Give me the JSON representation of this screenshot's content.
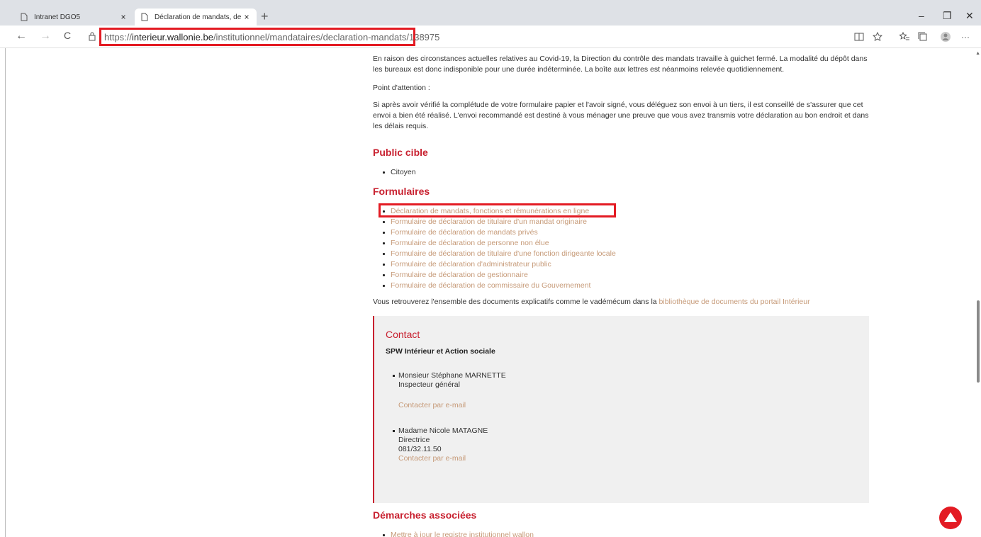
{
  "browser": {
    "tabs": [
      {
        "title": "Intranet DGO5",
        "close": "×"
      },
      {
        "title": "Déclaration de mandats, de fonc",
        "close": "×"
      }
    ],
    "new_tab": "+",
    "window_controls": {
      "minimize": "–",
      "restore": "❐",
      "close": "✕"
    },
    "nav": {
      "back": "←",
      "forward": "→",
      "reload": "C"
    },
    "url": {
      "scheme": "https://",
      "host": "interieur.wallonie.be",
      "path": "/institutionnel/mandataires/declaration-mandats/138975"
    },
    "toolbar_icons": [
      "reader-view-icon",
      "favorite-add-icon",
      "favorites-icon",
      "collections-icon",
      "profile-icon",
      "more-icon"
    ],
    "more": "···"
  },
  "content": {
    "intro1": "En raison des circonstances actuelles relatives au Covid-19, la Direction du contrôle des mandats travaille à guichet fermé. La modalité du dépôt dans les bureaux est donc indisponible pour une durée indéterminée. La boîte aux lettres est néanmoins relevée quotidiennement.",
    "attention_label": "Point d'attention :",
    "attention_text": "Si après avoir vérifié la complétude de votre formulaire papier et l'avoir signé, vous déléguez son envoi à un tiers, il est conseillé de s'assurer que cet envoi a bien été réalisé. L'envoi recommandé est destiné à vous ménager une preuve que vous avez transmis votre déclaration au bon endroit et dans les délais requis.",
    "public_title": "Public cible",
    "public_items": [
      "Citoyen"
    ],
    "forms_title": "Formulaires",
    "forms": [
      "Déclaration de mandats, fonctions et rémunérations en ligne",
      "Formulaire de déclaration de titulaire d'un mandat originaire",
      "Formulaire de déclaration de mandats privés",
      "Formulaire de déclaration de personne non élue",
      "Formulaire de déclaration de titulaire d'une fonction dirigeante locale",
      "Formulaire de déclaration d'administrateur public",
      "Formulaire de déclaration de gestionnaire",
      "Formulaire de déclaration de commissaire du Gouvernement"
    ],
    "docs_text": "Vous retrouverez l'ensemble des documents explicatifs comme le vadémécum dans la ",
    "docs_link": "bibliothèque de documents du portail Intérieur",
    "contact": {
      "title": "Contact",
      "org": "SPW Intérieur et Action sociale",
      "people": [
        {
          "name": "Monsieur Stéphane MARNETTE",
          "role": "Inspecteur général",
          "phone": "",
          "email_link": "Contacter par e-mail"
        },
        {
          "name": "Madame Nicole MATAGNE",
          "role": "Directrice",
          "phone": "081/32.11.50",
          "email_link": "Contacter par e-mail"
        }
      ]
    },
    "related_title": "Démarches associées",
    "related_items": [
      "Mettre à jour le registre institutionnel wallon"
    ]
  },
  "colors": {
    "accent": "#c8202f",
    "link": "#c69a78",
    "highlight": "#e31b23",
    "contact_bg": "#f0f0f0"
  }
}
